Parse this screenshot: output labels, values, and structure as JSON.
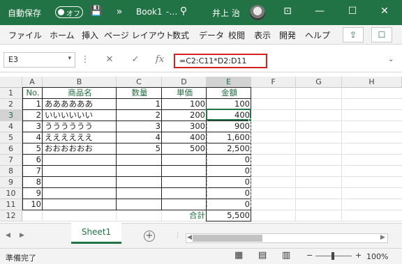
{
  "app": {
    "autosave_label": "自動保存",
    "autosave_state": "オフ",
    "doc_title": "Book1",
    "title_ellipsis": "-…",
    "overflow": "»",
    "user_name": "井上 治"
  },
  "titlebar_icons": {
    "save": "save-icon",
    "search": "search-icon",
    "ribbon_display": "ribbon-display-icon",
    "min": "minimize-icon",
    "max": "maximize-icon",
    "close": "close-icon",
    "chars": {
      "save": "💾",
      "more": "»",
      "search": "⚲",
      "ribbon_display": "⊡",
      "min": "—",
      "max": "☐",
      "close": "✕"
    }
  },
  "ribbon": {
    "tabs": [
      "ファイル",
      "ホーム",
      "挿入",
      "ページ レイアウト",
      "数式",
      "データ",
      "校閲",
      "表示",
      "開発",
      "ヘルプ"
    ],
    "share_icon": "⇪",
    "comment_icon": "☐"
  },
  "formula_bar": {
    "name_box": "E3",
    "name_arrow": "▾",
    "cancel": "✕",
    "enter": "✓",
    "fx": "fx",
    "formula": "=C2:C11*D2:D11",
    "expand": "⌄",
    "dots": "⋮"
  },
  "columns": [
    "A",
    "B",
    "C",
    "D",
    "E",
    "F",
    "G",
    "H"
  ],
  "rows": [
    "1",
    "2",
    "3",
    "4",
    "5",
    "6",
    "7",
    "8",
    "9",
    "10",
    "11",
    "12"
  ],
  "table": {
    "headers": {
      "no": "No.",
      "name": "商品名",
      "qty": "数量",
      "price": "単価",
      "amount": "金額"
    },
    "rows": [
      {
        "no": "1",
        "name": "ああああああ",
        "qty": "1",
        "price": "100",
        "amount": "100"
      },
      {
        "no": "2",
        "name": "いいいいいい",
        "qty": "2",
        "price": "200",
        "amount": "400"
      },
      {
        "no": "3",
        "name": "うううううう",
        "qty": "3",
        "price": "300",
        "amount": "900"
      },
      {
        "no": "4",
        "name": "ええええええ",
        "qty": "4",
        "price": "400",
        "amount": "1,600"
      },
      {
        "no": "5",
        "name": "おおおおおお",
        "qty": "5",
        "price": "500",
        "amount": "2,500"
      },
      {
        "no": "6",
        "name": "",
        "qty": "",
        "price": "",
        "amount": "0"
      },
      {
        "no": "7",
        "name": "",
        "qty": "",
        "price": "",
        "amount": "0"
      },
      {
        "no": "8",
        "name": "",
        "qty": "",
        "price": "",
        "amount": "0"
      },
      {
        "no": "9",
        "name": "",
        "qty": "",
        "price": "",
        "amount": "0"
      },
      {
        "no": "10",
        "name": "",
        "qty": "",
        "price": "",
        "amount": "0"
      }
    ],
    "total_label": "合計",
    "total_value": "5,500"
  },
  "sheet": {
    "tab": "Sheet1",
    "add": "+",
    "nav_prev": "◀",
    "nav_next": "▶",
    "dots": "⋮",
    "scroll_left": "◀",
    "scroll_right": "▶"
  },
  "status": {
    "ready": "準備完了",
    "zoom": "100%",
    "zoom_minus": "−",
    "zoom_plus": "+",
    "views": {
      "normal": "▦",
      "page_layout": "▤",
      "page_break": "▥"
    }
  },
  "colors": {
    "excel_green": "#217346",
    "header_green": "#1e6c3c",
    "formula_highlight": "#d42020"
  }
}
